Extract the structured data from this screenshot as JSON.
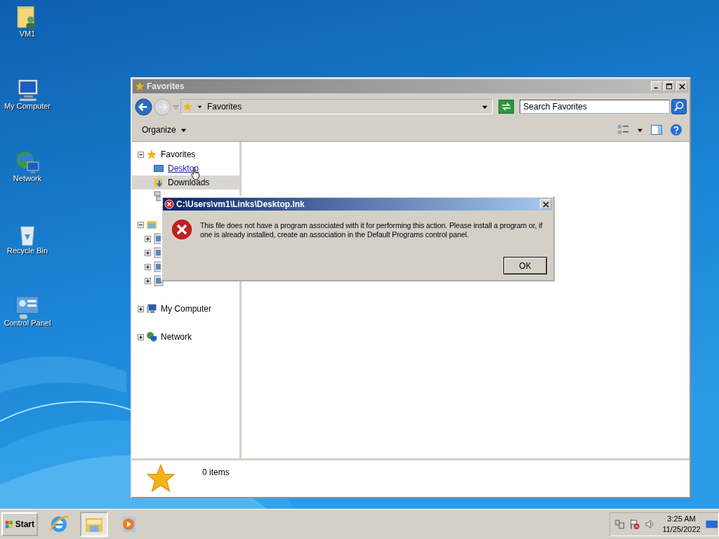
{
  "desktop_icons": [
    {
      "label": "VM1",
      "kind": "user-folder"
    },
    {
      "label": "My Computer",
      "kind": "computer"
    },
    {
      "label": "Network",
      "kind": "network"
    },
    {
      "label": "Recycle Bin",
      "kind": "recycle-bin"
    },
    {
      "label": "Control Panel",
      "kind": "control-panel"
    }
  ],
  "explorer": {
    "title": "Favorites",
    "address": "Favorites",
    "search": {
      "placeholder": "Search Favorites"
    },
    "organize": "Organize",
    "tree": [
      {
        "label": "Favorites",
        "kind": "favorites",
        "expanded": true,
        "selected": false,
        "children": [
          {
            "label": "Desktop",
            "kind": "desktop",
            "hovered": true,
            "selected": false
          },
          {
            "label": "Downloads",
            "kind": "downloads",
            "hovered": false,
            "selected": true
          },
          {
            "kind": "recent",
            "selected": false
          }
        ]
      },
      {
        "kind": "libraries",
        "expanded": true,
        "selected": false,
        "children": [
          {
            "kind": "documents",
            "expanded": false,
            "selected": false
          },
          {
            "kind": "music",
            "expanded": false,
            "selected": false
          },
          {
            "kind": "pictures",
            "expanded": false,
            "selected": false
          },
          {
            "kind": "videos",
            "expanded": false,
            "selected": false
          }
        ]
      },
      {
        "label": "My Computer",
        "kind": "computer",
        "expanded": false,
        "selected": false
      },
      {
        "label": "Network",
        "kind": "network",
        "expanded": false,
        "selected": false
      }
    ],
    "status": "0 items"
  },
  "dialog": {
    "title": "C:\\Users\\vm1\\Links\\Desktop.lnk",
    "message": "This file does not have a program associated with it for performing this action. Please install a program or, if one is already installed, create an association in the Default Programs control panel.",
    "button": "OK"
  },
  "taskbar": {
    "start": "Start",
    "apps": [
      {
        "kind": "browser",
        "active": false
      },
      {
        "kind": "folder",
        "active": true
      },
      {
        "kind": "media",
        "active": false
      }
    ],
    "time": "3:25 AM",
    "date": "11/25/2022"
  }
}
